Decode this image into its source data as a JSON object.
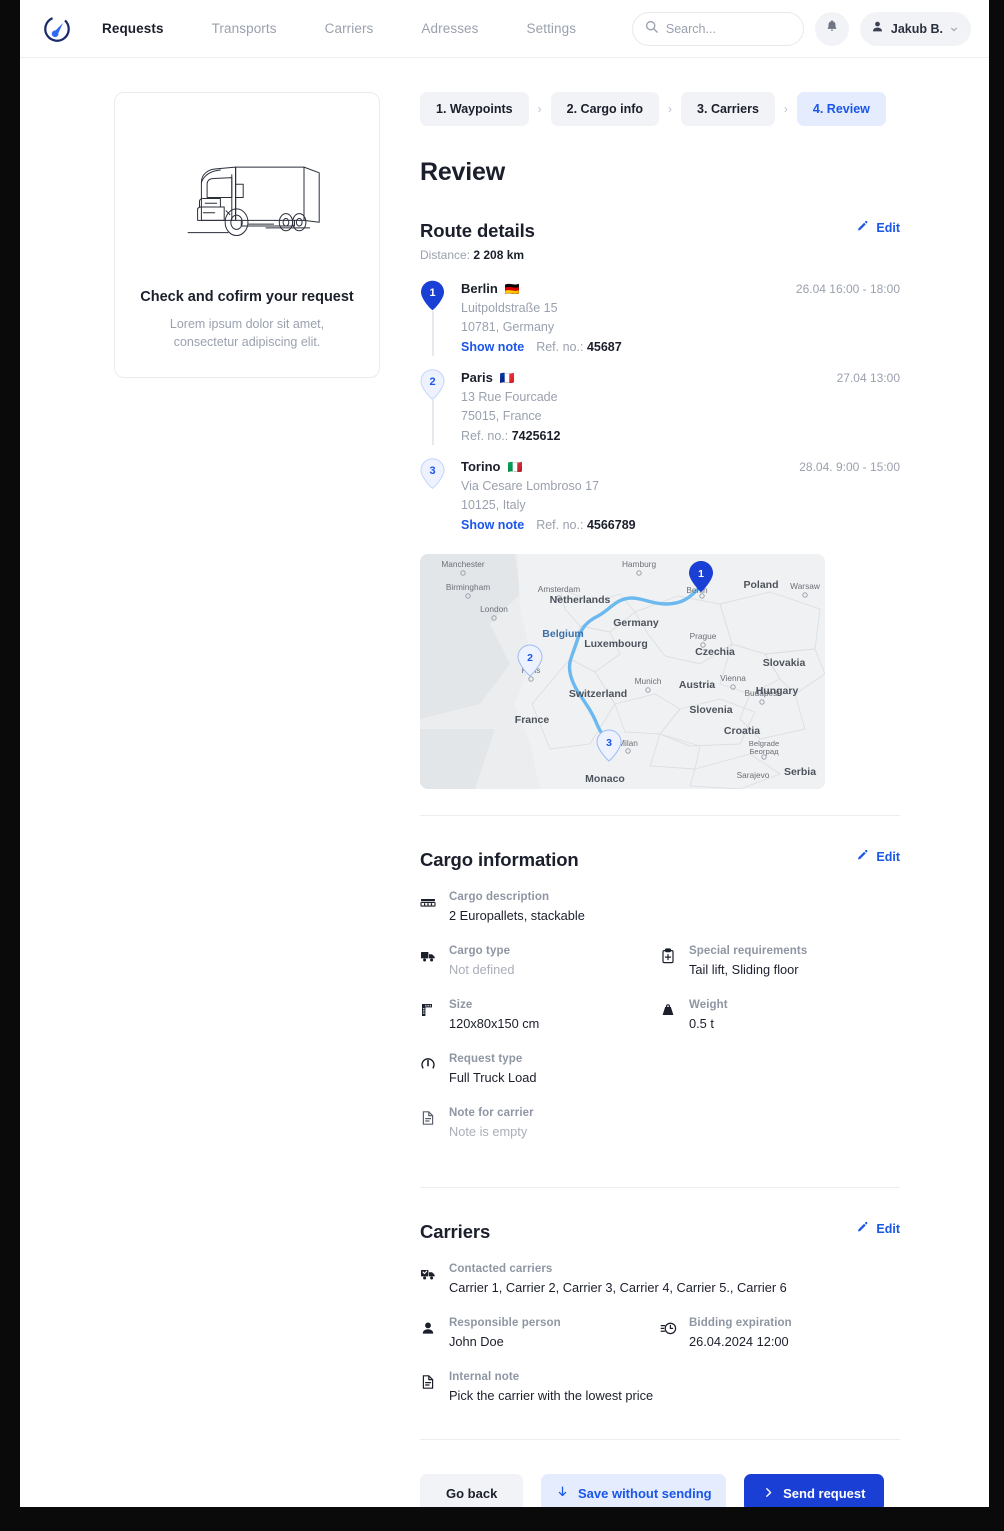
{
  "header": {
    "logo_icon": "compass-logo-icon",
    "nav": [
      {
        "label": "Requests",
        "active": true
      },
      {
        "label": "Transports",
        "active": false
      },
      {
        "label": "Carriers",
        "active": false
      },
      {
        "label": "Adresses",
        "active": false
      },
      {
        "label": "Settings",
        "active": false
      }
    ],
    "search": {
      "placeholder": "Search...",
      "value": "",
      "icon": "search-icon"
    },
    "notifications_icon": "bell-icon",
    "user": {
      "name": "Jakub B.",
      "avatar_icon": "user-icon",
      "caret_icon": "chevron-down-icon"
    }
  },
  "promo": {
    "illustration": "truck-line-art",
    "title": "Check and cofirm your request",
    "subtitle": "Lorem ipsum dolor sit amet, consectetur adipiscing elit."
  },
  "stepper": {
    "steps": [
      {
        "label": "1. Waypoints",
        "active": false
      },
      {
        "label": "2. Cargo info",
        "active": false
      },
      {
        "label": "3. Carriers",
        "active": false
      },
      {
        "label": "4. Review",
        "active": true
      }
    ],
    "separator": "›"
  },
  "page_title": "Review",
  "route": {
    "heading": "Route details",
    "distance_label": "Distance:",
    "distance_value": "2 208 km",
    "edit_label": "Edit",
    "edit_icon": "pencil-icon",
    "waypoints": [
      {
        "num": "1",
        "city": "Berlin",
        "flag": "🇩🇪",
        "street": "Luitpoldstraße 15",
        "region": "10781, Germany",
        "show_note": "Show note",
        "ref_label": "Ref. no.:",
        "ref_value": "45687",
        "time": "26.04 16:00 - 18:00",
        "active": true
      },
      {
        "num": "2",
        "city": "Paris",
        "flag": "🇫🇷",
        "street": "13 Rue Fourcade",
        "region": "75015,  France",
        "show_note": "",
        "ref_label": "Ref. no.:",
        "ref_value": "7425612",
        "time": "27.04 13:00",
        "active": false
      },
      {
        "num": "3",
        "city": "Torino",
        "flag": "🇮🇹",
        "street": "Via Cesare Lombroso 17",
        "region": "10125, Italy",
        "show_note": "Show note",
        "ref_label": "Ref. no.:",
        "ref_value": "4566789",
        "time": "28.04. 9:00 - 15:00",
        "active": false
      }
    ]
  },
  "map": {
    "pin_labels": [
      "1",
      "2",
      "3"
    ],
    "route_color": "#6bb9ef",
    "countries": [
      "Poland",
      "Netherlands",
      "Germany",
      "Belgium",
      "Luxembourg",
      "Czechia",
      "Slovakia",
      "Austria",
      "Hungary",
      "Switzerland",
      "Slovenia",
      "Croatia",
      "Serbia",
      "France",
      "Monaco"
    ],
    "cities": [
      "Manchester",
      "Birmingham",
      "London",
      "Amsterdam",
      "Hamburg",
      "Berlin",
      "Warsaw",
      "Prague",
      "Munich",
      "Vienna",
      "Budapest",
      "Paris",
      "Milan",
      "Belgrade\nБеоград",
      "Sarajevo"
    ]
  },
  "cargo": {
    "heading": "Cargo information",
    "edit_label": "Edit",
    "edit_icon": "pencil-icon",
    "fields": {
      "description": {
        "icon": "pallet-icon",
        "label": "Cargo description",
        "value": "2 Europallets, stackable"
      },
      "type": {
        "icon": "truck-icon",
        "label": "Cargo type",
        "value": "Not defined",
        "muted": true
      },
      "special": {
        "icon": "clipboard-plus-icon",
        "label": "Special requirements",
        "value": "Tail lift, Sliding floor"
      },
      "size": {
        "icon": "ruler-icon",
        "label": "Size",
        "value": "120x80x150 cm"
      },
      "weight": {
        "icon": "weight-icon",
        "label": "Weight",
        "value": "0.5 t"
      },
      "request_type": {
        "icon": "gauge-icon",
        "label": "Request type",
        "value": "Full Truck Load"
      },
      "note": {
        "icon": "document-icon",
        "label": "Note for carrier",
        "value": "Note is empty",
        "muted": true
      }
    }
  },
  "carriers": {
    "heading": "Carriers",
    "edit_label": "Edit",
    "edit_icon": "pencil-icon",
    "fields": {
      "contacted": {
        "icon": "truck-check-icon",
        "label": "Contacted carriers",
        "value": "Carrier 1, Carrier 2, Carrier 3, Carrier 4, Carrier 5., Carrier 6"
      },
      "responsible": {
        "icon": "person-icon",
        "label": "Responsible person",
        "value": "John Doe"
      },
      "bidding": {
        "icon": "clock-timer-icon",
        "label": "Bidding expiration",
        "value": "26.04.2024 12:00"
      },
      "internal_note": {
        "icon": "document-icon",
        "label": "Internal note",
        "value": "Pick the carrier with the lowest price"
      }
    }
  },
  "footer": {
    "go_back": "Go back",
    "save": "Save without sending",
    "save_icon": "arrow-down-icon",
    "send": "Send request",
    "send_icon": "chevron-right-icon"
  },
  "colors": {
    "accent": "#1a56e8",
    "primary_button": "#1a3fd4",
    "soft_accent": "#e4ecfe",
    "text": "#1b1f2b",
    "muted": "#9aa1ae",
    "chip": "#f2f3f6"
  }
}
